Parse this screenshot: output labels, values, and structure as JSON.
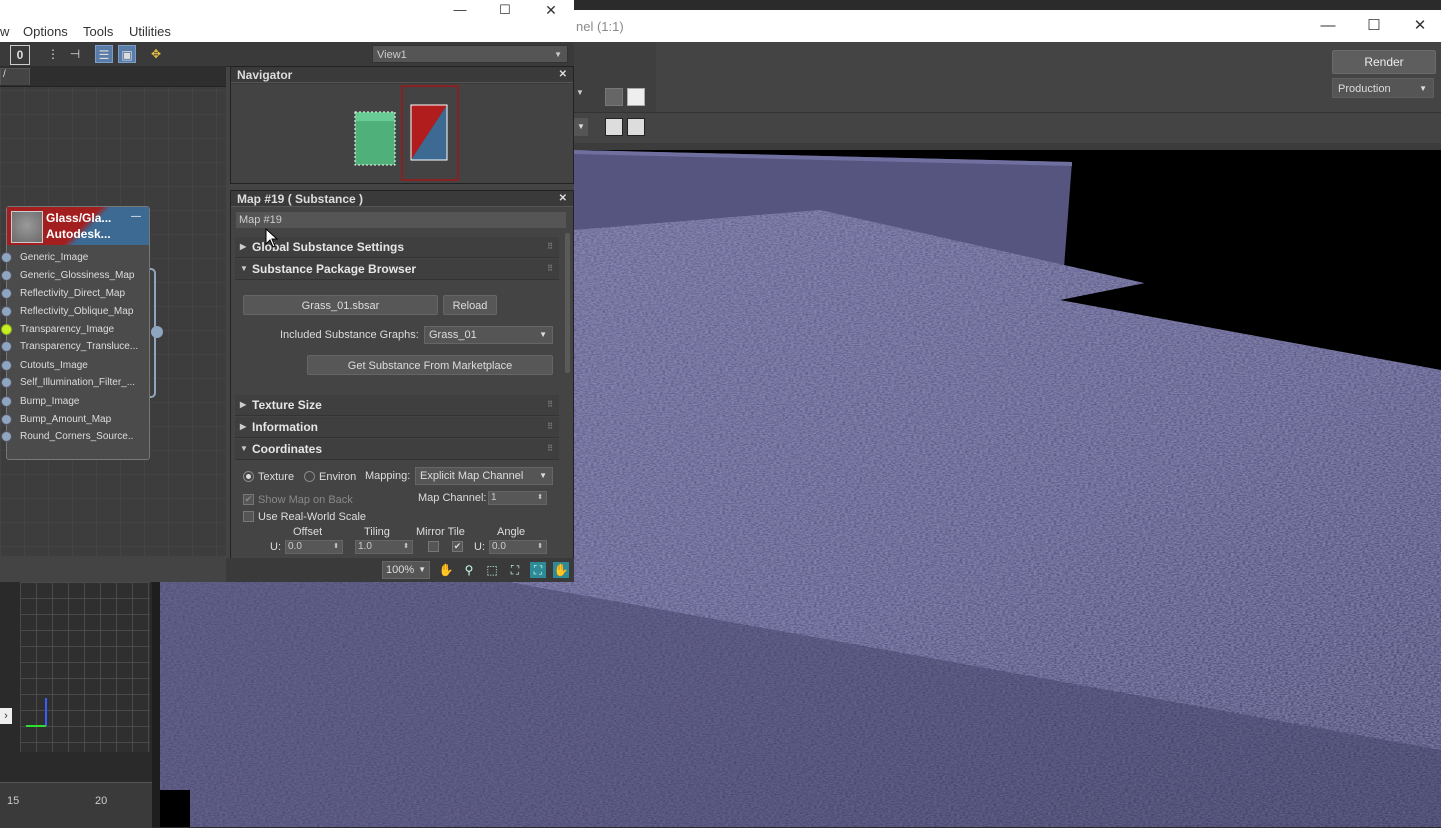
{
  "render_window": {
    "title": "nel (1:1)",
    "render_label": "Render",
    "preset": "Production"
  },
  "slate": {
    "menu": [
      "w",
      "Options",
      "Tools",
      "Utilities"
    ],
    "view_select": "View1",
    "view_tab": "/",
    "node": {
      "title_line1": "Glass/Gla...",
      "title_line2": "Autodesk...",
      "slots": [
        {
          "label": "Generic_Image",
          "active": false
        },
        {
          "label": "Generic_Glossiness_Map",
          "active": false
        },
        {
          "label": "Reflectivity_Direct_Map",
          "active": false
        },
        {
          "label": "Reflectivity_Oblique_Map",
          "active": false
        },
        {
          "label": "Transparency_Image",
          "active": true
        },
        {
          "label": "Transparency_Transluce...",
          "active": false
        },
        {
          "label": "Cutouts_Image",
          "active": false
        },
        {
          "label": "Self_Illumination_Filter_...",
          "active": false
        },
        {
          "label": "Bump_Image",
          "active": false
        },
        {
          "label": "Bump_Amount_Map",
          "active": false
        },
        {
          "label": "Round_Corners_Source..",
          "active": false
        }
      ]
    },
    "navigator_title": "Navigator",
    "params": {
      "title": "Map #19  ( Substance )",
      "map_name": "Map #19",
      "rollouts": {
        "global": "Global Substance Settings",
        "browser": "Substance Package Browser",
        "texture_size": "Texture Size",
        "information": "Information",
        "coordinates": "Coordinates"
      },
      "package_file": "Grass_01.sbsar",
      "reload": "Reload",
      "graphs_label": "Included Substance Graphs:",
      "graphs_value": "Grass_01",
      "marketplace": "Get Substance From Marketplace",
      "texture_label": "Texture",
      "environ_label": "Environ",
      "mapping_label": "Mapping:",
      "mapping_value": "Explicit Map Channel",
      "show_map_label": "Show Map on Back",
      "map_channel_label": "Map Channel:",
      "map_channel_value": "1",
      "realworld_label": "Use Real-World Scale",
      "offset_label": "Offset",
      "tiling_label": "Tiling",
      "mirror_tile_label": "Mirror Tile",
      "angle_label": "Angle",
      "u_label": "U:",
      "offset_u": "0.0",
      "tiling_u": "1.0",
      "angle_u": "0.0"
    },
    "zoom": "100%"
  },
  "timeline": {
    "ticks": [
      "15",
      "20"
    ]
  },
  "colors": {
    "grass": "#5b5a8a",
    "node_red": "#a31f1f",
    "node_blue": "#3c6a92",
    "slot_active": "#c8f020"
  }
}
